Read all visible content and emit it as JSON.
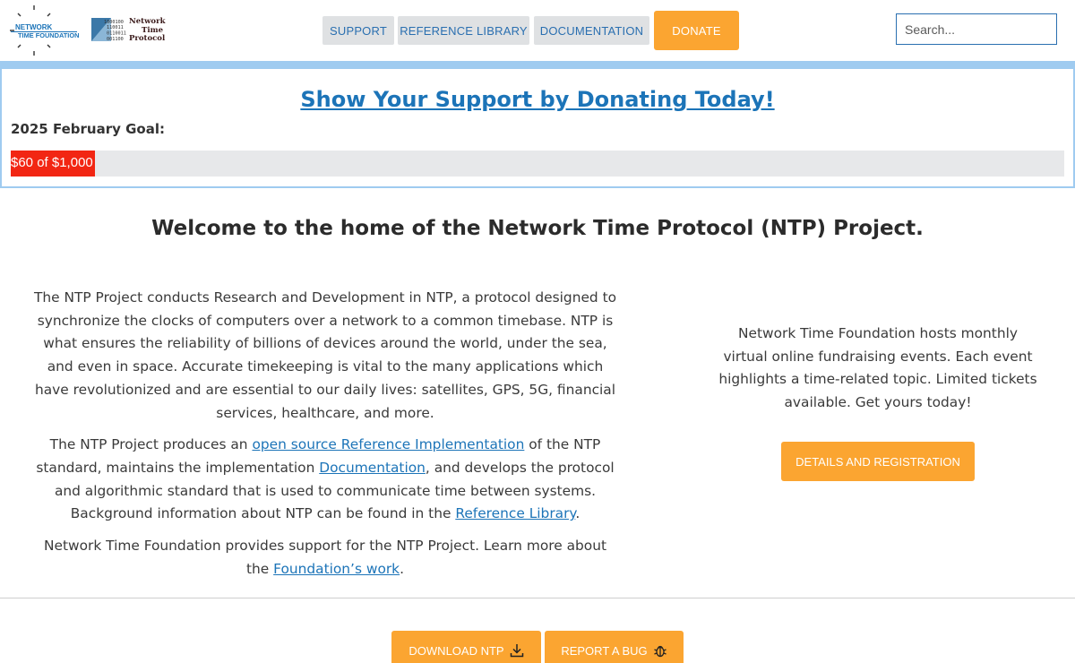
{
  "header": {
    "logo_ntf": {
      "line1": "NETWORK",
      "line2": "TIME FOUNDATION"
    },
    "logo_ntp": {
      "line1": "Network",
      "line2": "Time",
      "line3": "Protocol",
      "binary": [
        "1000100",
        "110011",
        "0110011",
        "001100"
      ]
    },
    "nav": {
      "support": "SUPPORT",
      "reference_library": "REFERENCE LIBRARY",
      "documentation": "DOCUMENTATION",
      "donate": "DONATE"
    },
    "search": {
      "placeholder": "Search..."
    }
  },
  "donation": {
    "title": "Show Your Support by Donating Today!",
    "goal_label": "2025 February Goal:",
    "progress_text": "$60 of $1,000",
    "progress_fraction": 0.08
  },
  "main": {
    "welcome": "Welcome to the home of the Network Time Protocol (NTP) Project.",
    "para1": "The NTP Project conducts Research and Development in NTP, a protocol designed to synchronize the clocks of computers over a network to a common timebase. NTP is what ensures the reliability of billions of devices around the world, under the sea, and even in space. Accurate timekeeping is vital to the many applications which have revolutionized and are essential to our daily lives: satellites, GPS, 5G, financial services, healthcare, and more.",
    "para2": {
      "t1": "The NTP Project produces an ",
      "link1": "open source Reference Implementation",
      "t2": " of the NTP standard, maintains the implementation ",
      "link2": "Documentation",
      "t3": ", and develops the protocol and algorithmic standard that is used to communicate time between systems. Background information about NTP can be found in the ",
      "link3": "Reference Library",
      "t4": "."
    },
    "para3": {
      "t1": "Network Time Foundation provides support for the NTP Project. Learn more about the ",
      "link1": "Foundation’s work",
      "t2": "."
    },
    "events_text": "Network Time Foundation hosts monthly virtual online fundraising events. Each event highlights a time-related topic. Limited tickets available. Get yours today!",
    "details_button": "DETAILS AND REGISTRATION"
  },
  "footer_actions": {
    "download": "DOWNLOAD NTP",
    "bug": "REPORT A BUG"
  },
  "colors": {
    "accent_orange": "#fba531",
    "link_blue": "#1c74b8",
    "progress_red": "#f22613",
    "strip_blue": "#9fcbf0"
  }
}
